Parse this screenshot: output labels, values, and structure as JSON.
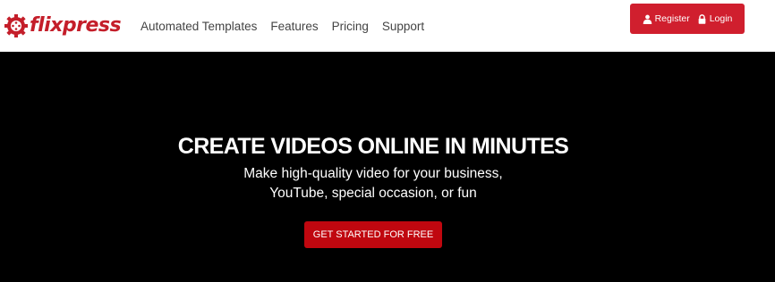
{
  "brand": {
    "name": "flixpress",
    "color": "#c41e2a",
    "logo_icon": "gear-film-reel-icon"
  },
  "nav": {
    "items": [
      {
        "label": "Automated Templates"
      },
      {
        "label": "Features"
      },
      {
        "label": "Pricing"
      },
      {
        "label": "Support"
      }
    ]
  },
  "auth": {
    "register_label": "Register",
    "register_icon": "user-icon",
    "login_label": "Login",
    "login_icon": "lock-icon",
    "color": "#d01f2e"
  },
  "hero": {
    "title": "CREATE VIDEOS ONLINE IN MINUTES",
    "subtitle_line1": "Make high-quality video for your business,",
    "subtitle_line2": "YouTube, special occasion, or fun",
    "cta_label": "GET STARTED FOR FREE",
    "cta_color": "#c0070f",
    "background": "#000000"
  }
}
